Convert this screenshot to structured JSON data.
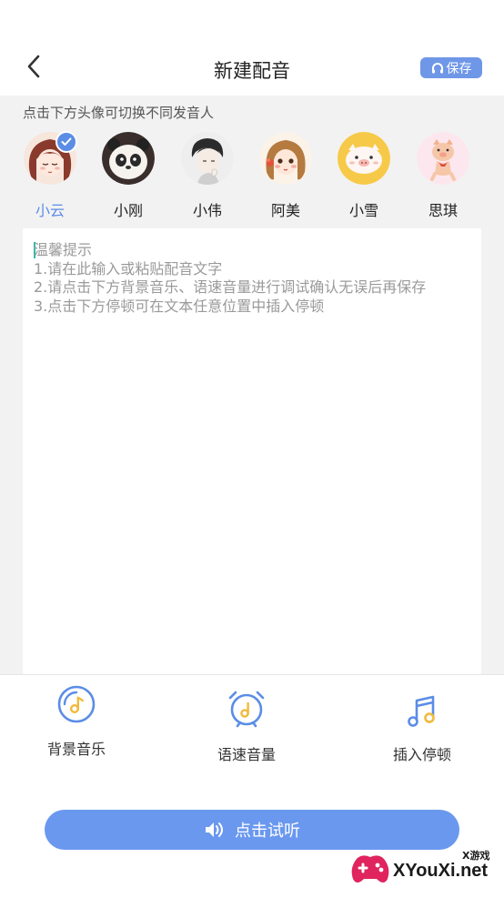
{
  "header": {
    "title": "新建配音",
    "save_label": "保存"
  },
  "hint": "点击下方头像可切换不同发音人",
  "voices": [
    {
      "name": "小云",
      "selected": true
    },
    {
      "name": "小刚",
      "selected": false
    },
    {
      "name": "小伟",
      "selected": false
    },
    {
      "name": "阿美",
      "selected": false
    },
    {
      "name": "小雪",
      "selected": false
    },
    {
      "name": "思琪",
      "selected": false
    }
  ],
  "editor": {
    "placeholder": "温馨提示\n1.请在此输入或粘贴配音文字\n2.请点击下方背景音乐、语速音量进行调试确认无误后再保存\n3.点击下方停顿可在文本任意位置中插入停顿"
  },
  "tools": {
    "background_music": "背景音乐",
    "speed_volume": "语速音量",
    "insert_pause": "插入停顿"
  },
  "preview_label": "点击试听",
  "watermark": {
    "site": "XYouXi.net",
    "tag": "X游戏"
  },
  "colors": {
    "accent": "#6a98ef",
    "selected_text": "#5b8de6",
    "background": "#f2f2f2"
  }
}
